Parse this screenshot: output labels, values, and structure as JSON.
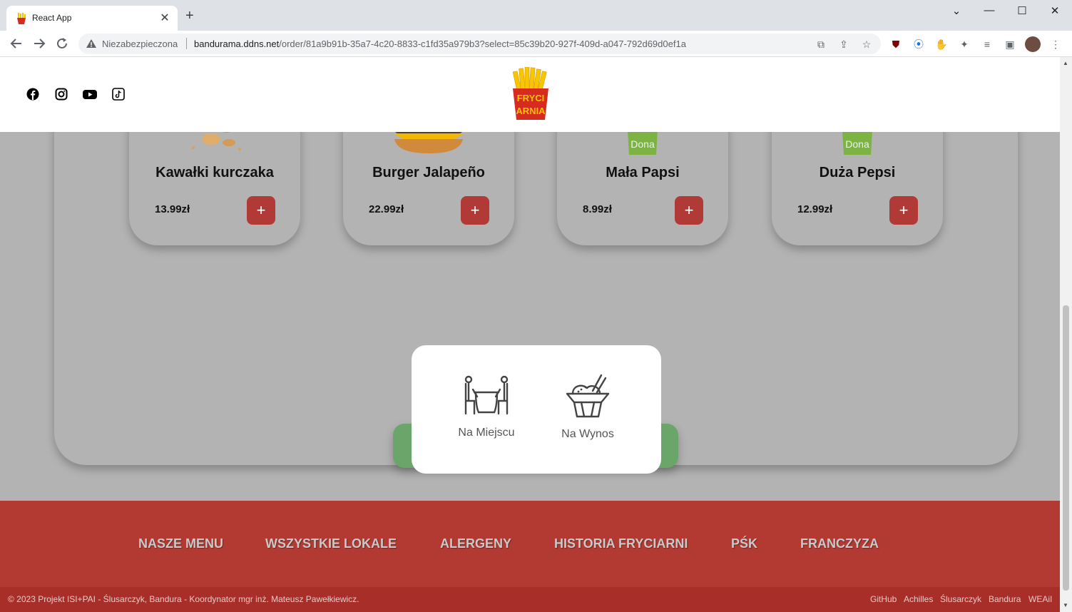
{
  "browser": {
    "tab_title": "React App",
    "tab_close": "✕",
    "new_tab": "+",
    "not_secure": "Niezabezpieczona",
    "url_host": "bandurama.ddns.net",
    "url_path": "/order/81a9b91b-35a7-4c20-8833-c1fd35a979b3?select=85c39b20-927f-409d-a047-792d69d0ef1a",
    "window_controls": {
      "chevron": "⌄",
      "minimize": "—",
      "maximize": "☐",
      "close": "✕"
    }
  },
  "products": [
    {
      "name": "Kawałki kurczaka",
      "price": "13.99zł",
      "add_label": "+"
    },
    {
      "name": "Burger Jalapeño",
      "price": "22.99zł",
      "add_label": "+"
    },
    {
      "name": "Mała Papsi",
      "price": "8.99zł",
      "add_label": "+"
    },
    {
      "name": "Duża Pepsi",
      "price": "12.99zł",
      "add_label": "+"
    }
  ],
  "modal": {
    "dine_in": "Na Miejscu",
    "takeaway": "Na Wynos"
  },
  "footer": {
    "links": [
      "NASZE MENU",
      "WSZYSTKIE LOKALE",
      "ALERGENY",
      "HISTORIA FRYCIARNI",
      "PŚK",
      "FRANCZYZA"
    ],
    "copyright": "© 2023 Projekt ISI+PAI - Ślusarczyk, Bandura - Koordynator mgr inż. Mateusz Pawełkiewicz.",
    "credits": [
      "GitHub",
      "Achilles",
      "Ślusarczyk",
      "Bandura",
      "WEAiI"
    ]
  },
  "logo_text": [
    "FRYCI",
    "ARNIA"
  ],
  "colors": {
    "accent_red": "#b23a32",
    "confirm_green": "#6aa66a",
    "panel_gray": "#b3b3b3"
  }
}
